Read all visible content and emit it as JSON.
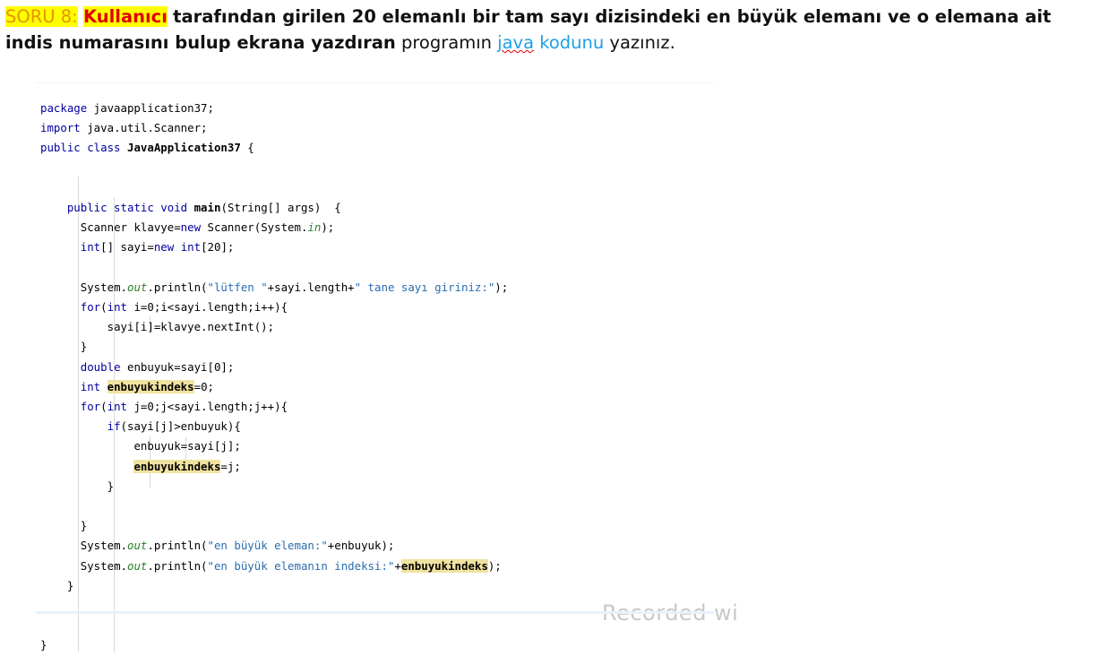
{
  "question": {
    "number": "SORU 8:",
    "user": "Kullanıcı",
    "bold_text": "tarafından girilen 20 elemanlı bir tam sayı dizisindeki en büyük elemanı ve o elemana ait indis numarasını bulup ekrana yazdıran",
    "plain1": "programın",
    "link_java": "java",
    "link_kodunu": "kodunu",
    "plain2": "yazınız."
  },
  "code": {
    "kw_package": "package",
    "package_name": " javaapplication37;",
    "kw_import": "import",
    "import_name": " java.util.Scanner;",
    "kw_public_class": "public class",
    "class_name": " JavaApplication37",
    "brace_open": " {",
    "kw_psv": "public static void",
    "main_name": "main",
    "main_sig": "(String[] args)  {",
    "scanner_decl": "Scanner klavye=",
    "kw_new": "new",
    "scanner_init": " Scanner(System.",
    "field_in": "in",
    "scanner_end": ");",
    "kw_int_arr": "int",
    "arr_mid": "[] sayi=",
    "kw_new2": "new",
    "kw_int": " int",
    "arr_end": "[20];",
    "print1_pre": "System.",
    "field_out": "out",
    "print1_mid": ".println(",
    "print1_s1": "\"lütfen \"",
    "print1_concat": "+sayi.length+",
    "print1_s2": "\" tane sayı giriniz:\"",
    "print1_end": ");",
    "kw_for": "for",
    "for1_paren": "(",
    "kw_int_for": "int",
    "for1_body": " i=0;i<sayi.length;i++){",
    "read_stmt": "sayi[i]=klavye.nextInt();",
    "close_brace": "}",
    "kw_double": "double",
    "double_stmt": " enbuyuk=sayi[0];",
    "kw_int2": "int",
    "var_enbuyukindeks": "enbuyukindeks",
    "int_stmt_end": "=0;",
    "kw_for2": "for",
    "kw_int_for2": "int",
    "for2_body": " j=0;j<sayi.length;j++){",
    "kw_if": "if",
    "if_cond": "(sayi[j]>enbuyuk){",
    "assign1": "enbuyuk=sayi[j];",
    "assign2_end": "=j;",
    "print2_mid": ".println(",
    "print2_s": "\"en büyük eleman:\"",
    "print2_end": "+enbuyuk);",
    "print3_s": "\"en büyük elemanın indeksi:\"",
    "print3_concat": "+",
    "print3_end": ");"
  },
  "watermark": "Recorded wi"
}
